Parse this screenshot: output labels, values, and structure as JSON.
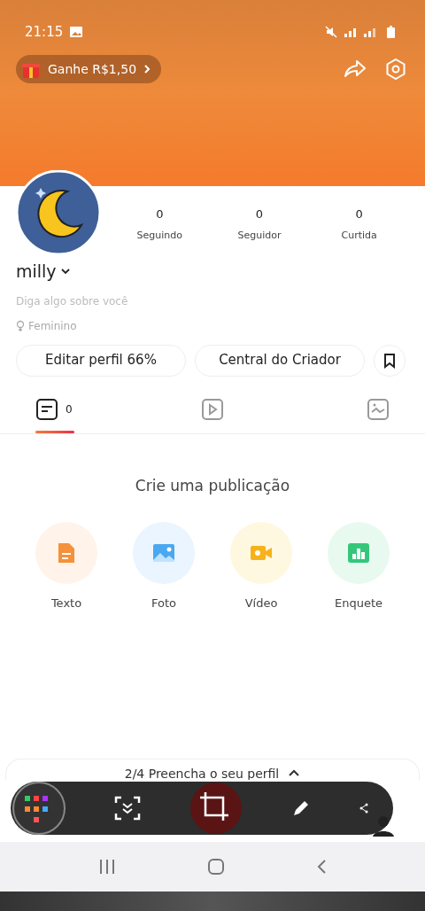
{
  "status_bar": {
    "time": "21:15"
  },
  "promo": {
    "label": "Ganhe R$1,50"
  },
  "stats": [
    {
      "value": "0",
      "label": "Seguindo"
    },
    {
      "value": "0",
      "label": "Seguidor"
    },
    {
      "value": "0",
      "label": "Curtida"
    }
  ],
  "profile": {
    "name": "milly",
    "bio_placeholder": "Diga algo sobre você",
    "gender": "Feminino"
  },
  "buttons": [
    "Editar perfil 66%",
    "Central do Criador"
  ],
  "tabs": [
    {
      "kind": "posts",
      "count": "0",
      "selected": true
    },
    {
      "kind": "video",
      "selected": false
    },
    {
      "kind": "image",
      "selected": false
    }
  ],
  "create": {
    "title": "Crie uma publicação",
    "options": [
      {
        "kind": "text",
        "label": "Texto",
        "color": "#f5913a"
      },
      {
        "kind": "photo",
        "label": "Foto",
        "color": "#4aa8f0"
      },
      {
        "kind": "video",
        "label": "Vídeo",
        "color": "#f7b21b"
      },
      {
        "kind": "poll",
        "label": "Enquete",
        "color": "#34c77b"
      }
    ]
  },
  "profile_prompt": {
    "text": "2/4 Preencha o seu perfil"
  }
}
